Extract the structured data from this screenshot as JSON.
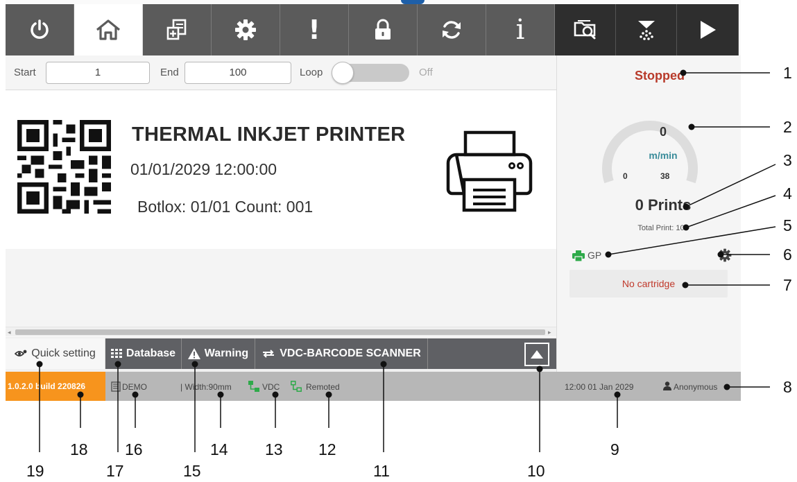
{
  "toolbar": {
    "icons": [
      "power-icon",
      "home-icon",
      "new-message-icon",
      "gear-icon",
      "warning-icon",
      "lock-icon",
      "sync-icon",
      "info-icon",
      "folder-search-icon",
      "ink-jet-icon",
      "play-icon"
    ],
    "active": "home-icon",
    "bang_glyph": "!",
    "info_glyph": "i"
  },
  "range": {
    "start_label": "Start",
    "start_value": "1",
    "end_label": "End",
    "end_value": "100",
    "loop_label": "Loop",
    "loop_state": "Off"
  },
  "message": {
    "title": "THERMAL INKJET PRINTER",
    "datetime": "01/01/2029 12:00:00",
    "line3": "Botlox:  01/01   Count:  001"
  },
  "tabs": {
    "quick": "Quick setting",
    "database": "Database",
    "warning": "Warning",
    "vdc": "VDC-BARCODE SCANNER",
    "up_glyph": "▲"
  },
  "panel": {
    "status": "Stopped",
    "speed": "0",
    "unit": "m/min",
    "gauge_min": "0",
    "gauge_max": "38",
    "prints": "0 Prints",
    "total": "Total Print: 100",
    "printer_name": "GP",
    "cartridge": "No cartridge"
  },
  "statusbar": {
    "version": "1.0.2.0 build 220826",
    "mode": "DEMO",
    "width": "| Width:90mm",
    "vdc": "VDC",
    "remote": "Remoted",
    "datetime": "12:00 01 Jan 2029",
    "user": "Anonymous"
  },
  "callouts": {
    "n1": "1",
    "n2": "2",
    "n3": "3",
    "n4": "4",
    "n5": "5",
    "n6": "6",
    "n7": "7",
    "n8": "8",
    "n9": "9",
    "n10": "10",
    "n11": "11",
    "n12": "12",
    "n13": "13",
    "n14": "14",
    "n15": "15",
    "n16": "16",
    "n17": "17",
    "n18": "18",
    "n19": "19"
  },
  "colors": {
    "toolbar": "#5b5b5b",
    "toolbar_dark": "#2e2e2e",
    "status_stopped": "#b83a2a",
    "unit_teal": "#3a8c9a",
    "version_orange": "#f7941d",
    "statusbar_grey": "#b7b7b7",
    "accent_green": "#2eaa4a",
    "cartridge_red": "#c0392b"
  }
}
